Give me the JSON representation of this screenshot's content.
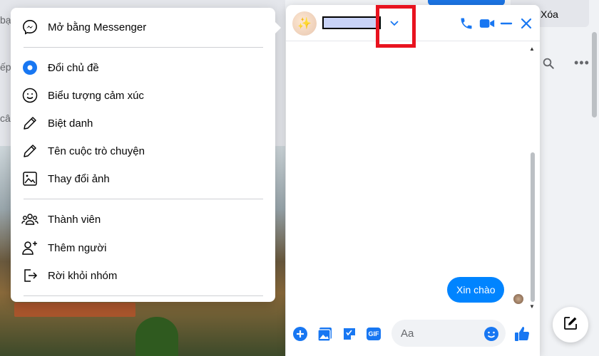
{
  "background": {
    "fragments": [
      "bạ",
      "ếp",
      "câ"
    ],
    "delete_button_label": "Xóa"
  },
  "chat": {
    "avatar_emoji": "✨",
    "contact_name": "",
    "messages": [
      {
        "sender": "me",
        "text": "Xin chào"
      }
    ],
    "composer": {
      "input_placeholder": "Aa",
      "gif_label": "GIF"
    }
  },
  "menu": {
    "items": [
      {
        "label": "Mở bằng Messenger",
        "icon": "messenger-icon"
      },
      {
        "label": "Đổi chủ đề",
        "icon": "theme-dot-icon"
      },
      {
        "label": "Biểu tượng cảm xúc",
        "icon": "smiley-icon"
      },
      {
        "label": "Biệt danh",
        "icon": "pencil-icon"
      },
      {
        "label": "Tên cuộc trò chuyện",
        "icon": "pencil-icon"
      },
      {
        "label": "Thay đổi ảnh",
        "icon": "image-icon"
      },
      {
        "label": "Thành viên",
        "icon": "members-icon"
      },
      {
        "label": "Thêm người",
        "icon": "add-person-icon"
      },
      {
        "label": "Rời khỏi nhóm",
        "icon": "leave-icon"
      }
    ]
  },
  "colors": {
    "accent": "#1877f2",
    "bubble": "#0084ff",
    "highlight_box": "#e8131f"
  }
}
